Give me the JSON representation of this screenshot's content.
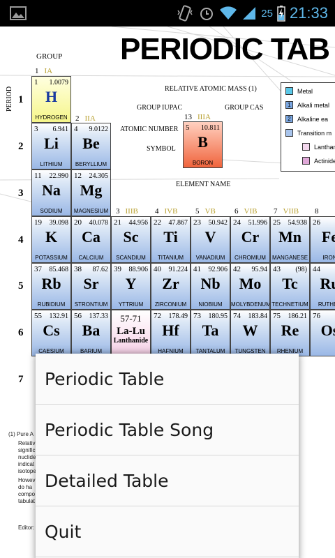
{
  "status_bar": {
    "battery_percent": "25",
    "time": "21:33"
  },
  "sheet": {
    "title": "PERIODIC TAB",
    "group_label": "GROUP",
    "period_label": "PERIOD",
    "groups": [
      {
        "num": "1",
        "iupac": "IA"
      },
      {
        "num": "2",
        "iupac": "IIA"
      },
      {
        "num": "3",
        "iupac": "IIIB"
      },
      {
        "num": "4",
        "iupac": "IVB"
      },
      {
        "num": "5",
        "iupac": "VB"
      },
      {
        "num": "6",
        "iupac": "VIB"
      },
      {
        "num": "7",
        "iupac": "VIIB"
      },
      {
        "num": "8",
        "iupac": ""
      },
      {
        "num": "13",
        "iupac": "IIIA"
      }
    ],
    "periods": [
      "1",
      "2",
      "3",
      "4",
      "5",
      "6",
      "7"
    ],
    "key": {
      "relative_atomic_mass": "RELATIVE ATOMIC MASS (1)",
      "group_iupac": "GROUP IUPAC",
      "group_cas": "GROUP CAS",
      "atomic_number": "ATOMIC NUMBER",
      "symbol": "SYMBOL",
      "element_name": "ELEMENT NAME"
    },
    "legend": [
      "Metal",
      "Alkali metal",
      "Alkaline ea",
      "Transition m",
      "Lanthan",
      "Actinide"
    ],
    "legend_nums": [
      "",
      "1",
      "2",
      "",
      "",
      ""
    ],
    "elements": [
      {
        "z": "1",
        "m": "1.0079",
        "s": "H",
        "n": "HYDROGEN"
      },
      {
        "z": "3",
        "m": "6.941",
        "s": "Li",
        "n": "LITHIUM"
      },
      {
        "z": "4",
        "m": "9.0122",
        "s": "Be",
        "n": "BERYLLIUM"
      },
      {
        "z": "11",
        "m": "22.990",
        "s": "Na",
        "n": "SODIUM"
      },
      {
        "z": "12",
        "m": "24.305",
        "s": "Mg",
        "n": "MAGNESIUM"
      },
      {
        "z": "19",
        "m": "39.098",
        "s": "K",
        "n": "POTASSIUM"
      },
      {
        "z": "20",
        "m": "40.078",
        "s": "Ca",
        "n": "CALCIUM"
      },
      {
        "z": "21",
        "m": "44.956",
        "s": "Sc",
        "n": "SCANDIUM"
      },
      {
        "z": "22",
        "m": "47.867",
        "s": "Ti",
        "n": "TITANIUM"
      },
      {
        "z": "23",
        "m": "50.942",
        "s": "V",
        "n": "VANADIUM"
      },
      {
        "z": "24",
        "m": "51.996",
        "s": "Cr",
        "n": "CHROMIUM"
      },
      {
        "z": "25",
        "m": "54.938",
        "s": "Mn",
        "n": "MANGANESE"
      },
      {
        "z": "26",
        "m": "",
        "s": "Fe",
        "n": "IRON"
      },
      {
        "z": "37",
        "m": "85.468",
        "s": "Rb",
        "n": "RUBIDIUM"
      },
      {
        "z": "38",
        "m": "87.62",
        "s": "Sr",
        "n": "STRONTIUM"
      },
      {
        "z": "39",
        "m": "88.906",
        "s": "Y",
        "n": "YTTRIUM"
      },
      {
        "z": "40",
        "m": "91.224",
        "s": "Zr",
        "n": "ZIRCONIUM"
      },
      {
        "z": "41",
        "m": "92.906",
        "s": "Nb",
        "n": "NIOBIUM"
      },
      {
        "z": "42",
        "m": "95.94",
        "s": "Mo",
        "n": "MOLYBDENUM"
      },
      {
        "z": "43",
        "m": "(98)",
        "s": "Tc",
        "n": "TECHNETIUM"
      },
      {
        "z": "44",
        "m": "",
        "s": "Ru",
        "n": "RUTHEN"
      },
      {
        "z": "55",
        "m": "132.91",
        "s": "Cs",
        "n": "CAESIUM"
      },
      {
        "z": "56",
        "m": "137.33",
        "s": "Ba",
        "n": "BARIUM"
      },
      {
        "z": "57-71",
        "m": "",
        "s": "La-Lu",
        "n": "Lanthanide"
      },
      {
        "z": "72",
        "m": "178.49",
        "s": "Hf",
        "n": "HAFNIUM"
      },
      {
        "z": "73",
        "m": "180.95",
        "s": "Ta",
        "n": "TANTALUM"
      },
      {
        "z": "74",
        "m": "183.84",
        "s": "W",
        "n": "TUNGSTEN"
      },
      {
        "z": "75",
        "m": "186.21",
        "s": "Re",
        "n": "RHENIUM"
      },
      {
        "z": "76",
        "m": "",
        "s": "Os",
        "n": ""
      },
      {
        "z": "5",
        "m": "10.811",
        "s": "B",
        "n": "BORON"
      }
    ],
    "fine_print": [
      "(1) Pure A",
      "Relativ",
      "signific",
      "nuclide",
      "indicat",
      "isotope",
      "Howev",
      "do ha",
      "compo",
      "tabulat",
      "Editor:"
    ]
  },
  "menu": {
    "items": [
      "Periodic Table",
      "Periodic Table Song",
      "Detailed Table",
      "Quit"
    ]
  }
}
